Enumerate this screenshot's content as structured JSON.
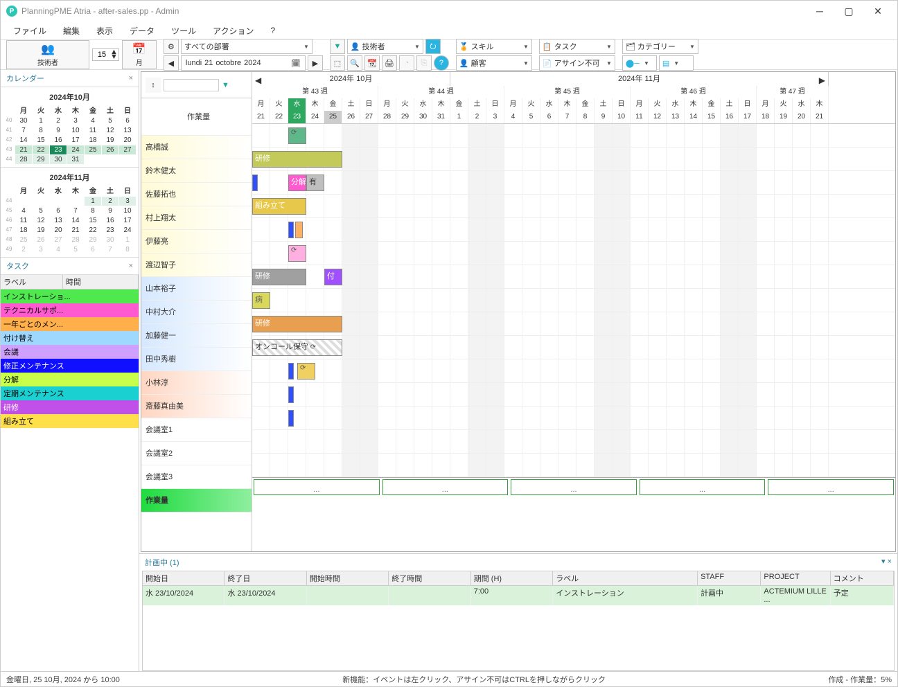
{
  "title": "PlanningPME Atria - after-sales.pp - Admin",
  "menu": [
    "ファイル",
    "編集",
    "表示",
    "データ",
    "ツール",
    "アクション",
    "?"
  ],
  "toolbar": {
    "tech_label": "技術者",
    "spin_value": "15",
    "month_label": "月",
    "dept": "すべての部署",
    "filter1": "技術者",
    "skill": "スキル",
    "task": "タスク",
    "category": "カテゴリー",
    "customer": "顧客",
    "unassign": "アサイン不可",
    "date": {
      "dow": "lundi",
      "d": "21",
      "m": "octobre",
      "y": "2024"
    }
  },
  "left": {
    "calendar_title": "カレンダー",
    "months": [
      {
        "title": "2024年10月",
        "weeks": [
          "40",
          "41",
          "42",
          "43",
          "44"
        ],
        "dh": [
          "月",
          "火",
          "水",
          "木",
          "金",
          "土",
          "日"
        ],
        "rows": [
          [
            "30",
            "1",
            "2",
            "3",
            "4",
            "5",
            "6"
          ],
          [
            "7",
            "8",
            "9",
            "10",
            "11",
            "12",
            "13"
          ],
          [
            "14",
            "15",
            "16",
            "17",
            "18",
            "19",
            "20"
          ],
          [
            "21",
            "22",
            "23",
            "24",
            "25",
            "26",
            "27"
          ],
          [
            "28",
            "29",
            "30",
            "31",
            "",
            "",
            ""
          ]
        ],
        "today": "23",
        "hl_row": 3,
        "hl2_row": 4
      },
      {
        "title": "2024年11月",
        "weeks": [
          "44",
          "45",
          "46",
          "47",
          "48",
          "49"
        ],
        "dh": [
          "月",
          "火",
          "水",
          "木",
          "金",
          "土",
          "日"
        ],
        "rows": [
          [
            "",
            "",
            "",
            "",
            "1",
            "2",
            "3"
          ],
          [
            "4",
            "5",
            "6",
            "7",
            "8",
            "9",
            "10"
          ],
          [
            "11",
            "12",
            "13",
            "14",
            "15",
            "16",
            "17"
          ],
          [
            "18",
            "19",
            "20",
            "21",
            "22",
            "23",
            "24"
          ],
          [
            "25",
            "26",
            "27",
            "28",
            "29",
            "30",
            "1"
          ],
          [
            "2",
            "3",
            "4",
            "5",
            "6",
            "7",
            "8"
          ]
        ]
      }
    ],
    "task_title": "タスク",
    "task_headers": [
      "ラベル",
      "時間"
    ],
    "tasks": [
      {
        "label": "インストレーショ...",
        "color": "#4fe84f"
      },
      {
        "label": "テクニカルサポ...",
        "color": "#ff5ad0"
      },
      {
        "label": "一年ごとのメン...",
        "color": "#ffb04a"
      },
      {
        "label": "付け替え",
        "color": "#9fd8ff"
      },
      {
        "label": "会議",
        "color": "#d0a0ff"
      },
      {
        "label": "修正メンテナンス",
        "color": "#1010ff",
        "fg": "#fff"
      },
      {
        "label": "分解",
        "color": "#c8ff4a"
      },
      {
        "label": "定期メンテナンス",
        "color": "#1ad0d0"
      },
      {
        "label": "研修",
        "color": "#c050e8",
        "fg": "#fff"
      },
      {
        "label": "組み立て",
        "color": "#ffe04a"
      }
    ]
  },
  "gantt": {
    "workload_title": "作業量",
    "months": [
      {
        "label": "2024年 10月",
        "span": 11
      },
      {
        "label": "2024年 11月",
        "span": 21
      }
    ],
    "weeks": [
      {
        "label": "第 43 週",
        "span": 7
      },
      {
        "label": "第 44 週",
        "span": 7
      },
      {
        "label": "第 45 週",
        "span": 7
      },
      {
        "label": "第 46 週",
        "span": 7
      },
      {
        "label": "第 47 週",
        "span": 4
      }
    ],
    "dows": [
      "月",
      "火",
      "水",
      "木",
      "金",
      "土",
      "日",
      "月",
      "火",
      "水",
      "木",
      "金",
      "土",
      "日",
      "月",
      "火",
      "水",
      "木",
      "金",
      "土",
      "日",
      "月",
      "火",
      "水",
      "木",
      "金",
      "土",
      "日",
      "月",
      "火",
      "水",
      "木"
    ],
    "dnums": [
      "21",
      "22",
      "23",
      "24",
      "25",
      "26",
      "27",
      "28",
      "29",
      "30",
      "31",
      "1",
      "2",
      "3",
      "4",
      "5",
      "6",
      "7",
      "8",
      "9",
      "10",
      "11",
      "12",
      "13",
      "14",
      "15",
      "16",
      "17",
      "18",
      "19",
      "20",
      "21"
    ],
    "today_idx": 2,
    "fri_idx": 4,
    "resources": [
      {
        "name": "高橋誠",
        "cls": "rgrad1",
        "bars": [
          {
            "start": 2,
            "span": 1,
            "color": "#5fb88a",
            "sync": true
          }
        ]
      },
      {
        "name": "鈴木健太",
        "cls": "rgrad1",
        "bars": [
          {
            "start": 0,
            "span": 5,
            "color": "#c4ca5a",
            "label": "研修"
          }
        ]
      },
      {
        "name": "佐藤拓也",
        "cls": "rgrad1",
        "bars": [
          {
            "start": 0,
            "span": 0.3,
            "color": "#3050ff"
          },
          {
            "start": 2,
            "span": 1,
            "color": "#ff5ad0",
            "label": "分解"
          },
          {
            "start": 3,
            "span": 1,
            "color": "#bfbfbf",
            "label": "有",
            "fg": "#333"
          }
        ]
      },
      {
        "name": "村上翔太",
        "cls": "rgrad1",
        "bars": [
          {
            "start": 0,
            "span": 3,
            "color": "#e8c84a",
            "label": "組み立て",
            "fg": "#fff"
          }
        ]
      },
      {
        "name": "伊藤亮",
        "cls": "rgrad1",
        "bars": [
          {
            "start": 2,
            "span": 0.3,
            "color": "#3050ff"
          },
          {
            "start": 2.4,
            "span": 0.4,
            "color": "#ffb060"
          }
        ]
      },
      {
        "name": "渡辺智子",
        "cls": "rgrad1",
        "bars": [
          {
            "start": 2,
            "span": 1,
            "color": "#ffb0e0",
            "sync": true
          }
        ]
      },
      {
        "name": "山本裕子",
        "cls": "rgrad2",
        "bars": [
          {
            "start": 0,
            "span": 3,
            "color": "#a0a0a0",
            "label": "研修"
          },
          {
            "start": 4,
            "span": 1,
            "color": "#a050ff",
            "label": "付"
          }
        ]
      },
      {
        "name": "中村大介",
        "cls": "rgrad2",
        "bars": [
          {
            "start": 0,
            "span": 1,
            "color": "#d8d85a",
            "label": "病",
            "fg": "#666"
          }
        ]
      },
      {
        "name": "加藤健一",
        "cls": "rgrad2",
        "bars": [
          {
            "start": 0,
            "span": 5,
            "color": "#e8a050",
            "label": "研修"
          }
        ]
      },
      {
        "name": "田中秀樹",
        "cls": "rgrad2",
        "bars": [
          {
            "start": 0,
            "span": 5,
            "color": "#fff",
            "label": "オンコール保守",
            "fg": "#333",
            "hatch": true,
            "sync": true
          }
        ]
      },
      {
        "name": "小林淳",
        "cls": "rgrad3",
        "bars": [
          {
            "start": 2,
            "span": 0.3,
            "color": "#3050ff"
          },
          {
            "start": 2.5,
            "span": 1,
            "color": "#f0d060",
            "sync": true
          }
        ]
      },
      {
        "name": "斎藤真由美",
        "cls": "rgrad3",
        "bars": [
          {
            "start": 2,
            "span": 0.3,
            "color": "#3050ff"
          }
        ]
      },
      {
        "name": "会議室1",
        "cls": "",
        "bars": [
          {
            "start": 2,
            "span": 0.3,
            "color": "#3050ff"
          }
        ]
      },
      {
        "name": "会議室2",
        "cls": "",
        "bars": []
      },
      {
        "name": "会議室3",
        "cls": "",
        "bars": []
      }
    ],
    "workload_footer": "作業量",
    "dots": "..."
  },
  "bottom": {
    "title": "計画中 (1)",
    "headers": [
      "開始日",
      "終了日",
      "開始時間",
      "終了時間",
      "期間 (H)",
      "ラベル",
      "STAFF",
      "PROJECT",
      "コメント"
    ],
    "widths": [
      130,
      130,
      130,
      130,
      130,
      230,
      100,
      110,
      100
    ],
    "row": [
      "水 23/10/2024",
      "水 23/10/2024",
      "",
      "",
      "7:00",
      "インストレーション",
      "計画中",
      "ACTEMIUM LILLE ...",
      "予定"
    ]
  },
  "status": {
    "left": "金曜日, 25 10月, 2024 から 10:00",
    "center": "新機能：イベントは左クリック、アサイン不可はCTRLを押しながらクリック",
    "right": "作成 - 作業量：5%"
  }
}
